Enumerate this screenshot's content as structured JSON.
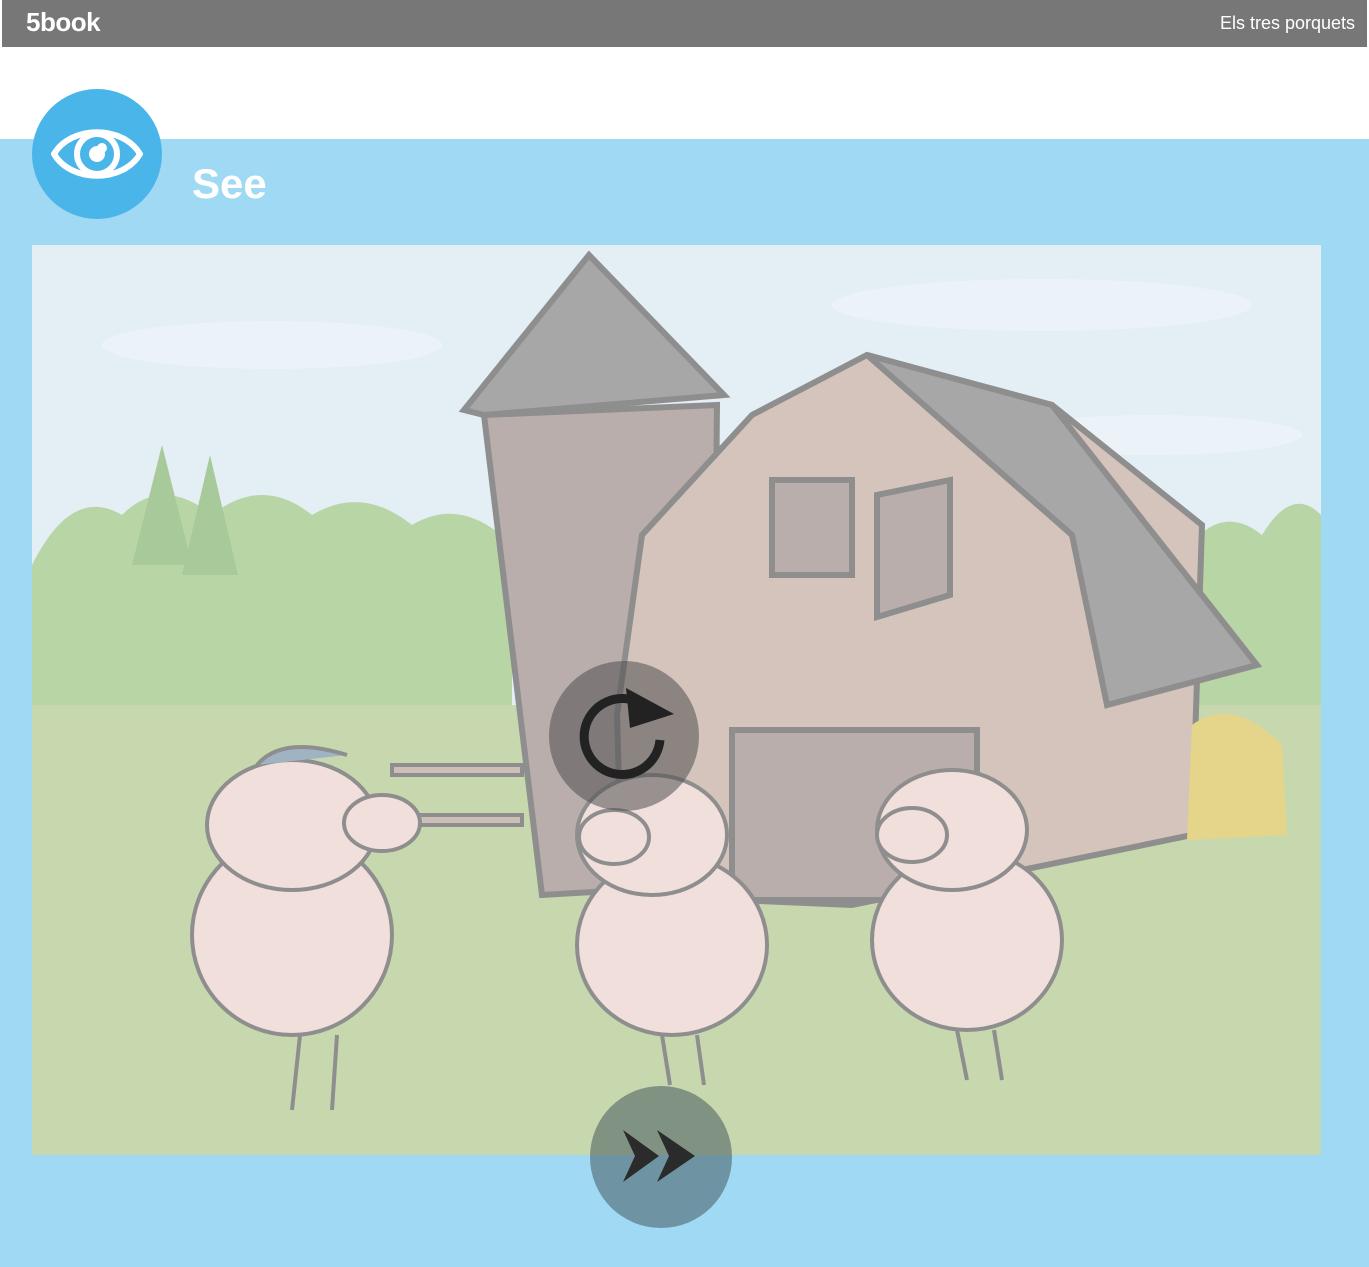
{
  "header": {
    "brand": "5book",
    "title": "Els tres porquets"
  },
  "section": {
    "icon": "eye-icon",
    "title": "See"
  },
  "scene": {
    "image": "three-little-pigs-farm-illustration",
    "overlay": "dimmed"
  },
  "controls": {
    "replay_icon": "replay-icon",
    "next_icon": "fast-forward-icon"
  },
  "colors": {
    "header_bg": "#777777",
    "panel_bg": "#a0d9f3",
    "badge_bg": "#4ab5e9"
  }
}
